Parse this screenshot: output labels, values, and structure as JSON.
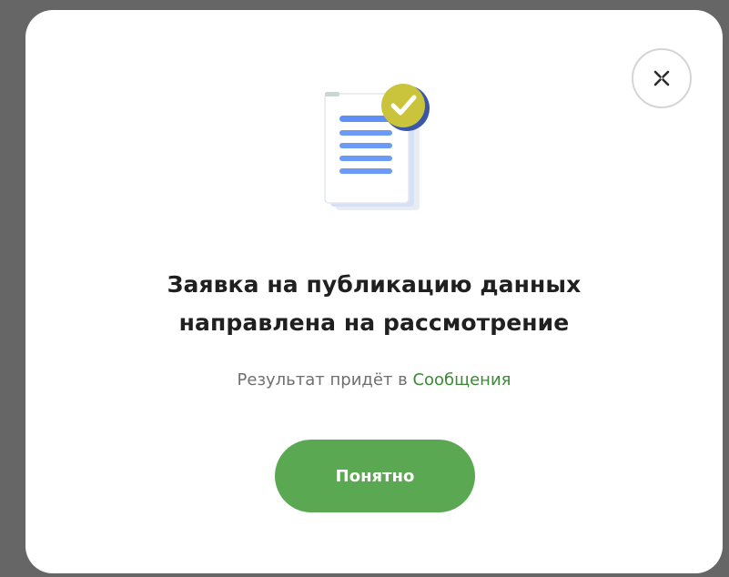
{
  "dialog": {
    "title_line1": "Заявка на публикацию данных",
    "title_line2": "направлена на рассмотрение",
    "subtitle_prefix": "Результат придёт в ",
    "subtitle_link": "Сообщения",
    "ok_label": "Понятно",
    "icons": {
      "close": "close-icon",
      "illustration": "document-check-icon"
    },
    "colors": {
      "accent": "#5aa851",
      "link": "#3a8a34",
      "document_lines": "#5d8ff5",
      "check_badge": "#c9c43b"
    }
  }
}
